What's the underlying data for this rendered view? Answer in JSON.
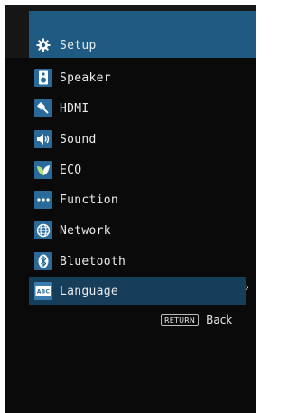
{
  "menu": {
    "items": [
      {
        "label": "Setup",
        "icon": "gear-icon"
      },
      {
        "label": "Speaker",
        "icon": "speaker-icon"
      },
      {
        "label": "HDMI",
        "icon": "hdmi-plug-icon"
      },
      {
        "label": "Sound",
        "icon": "sound-icon"
      },
      {
        "label": "ECO",
        "icon": "leaf-icon"
      },
      {
        "label": "Function",
        "icon": "dots-icon"
      },
      {
        "label": "Network",
        "icon": "globe-icon"
      },
      {
        "label": "Bluetooth",
        "icon": "bluetooth-icon"
      },
      {
        "label": "Language",
        "icon": "abc-icon"
      }
    ],
    "selected": "Language"
  },
  "footer": {
    "return_key": "RETURN",
    "back_label": "Back"
  },
  "colors": {
    "header_bar": "#1f5a82",
    "selected_row": "#163d5a",
    "icon_bg": "#2a6a9a",
    "background": "#0a0a0a"
  }
}
